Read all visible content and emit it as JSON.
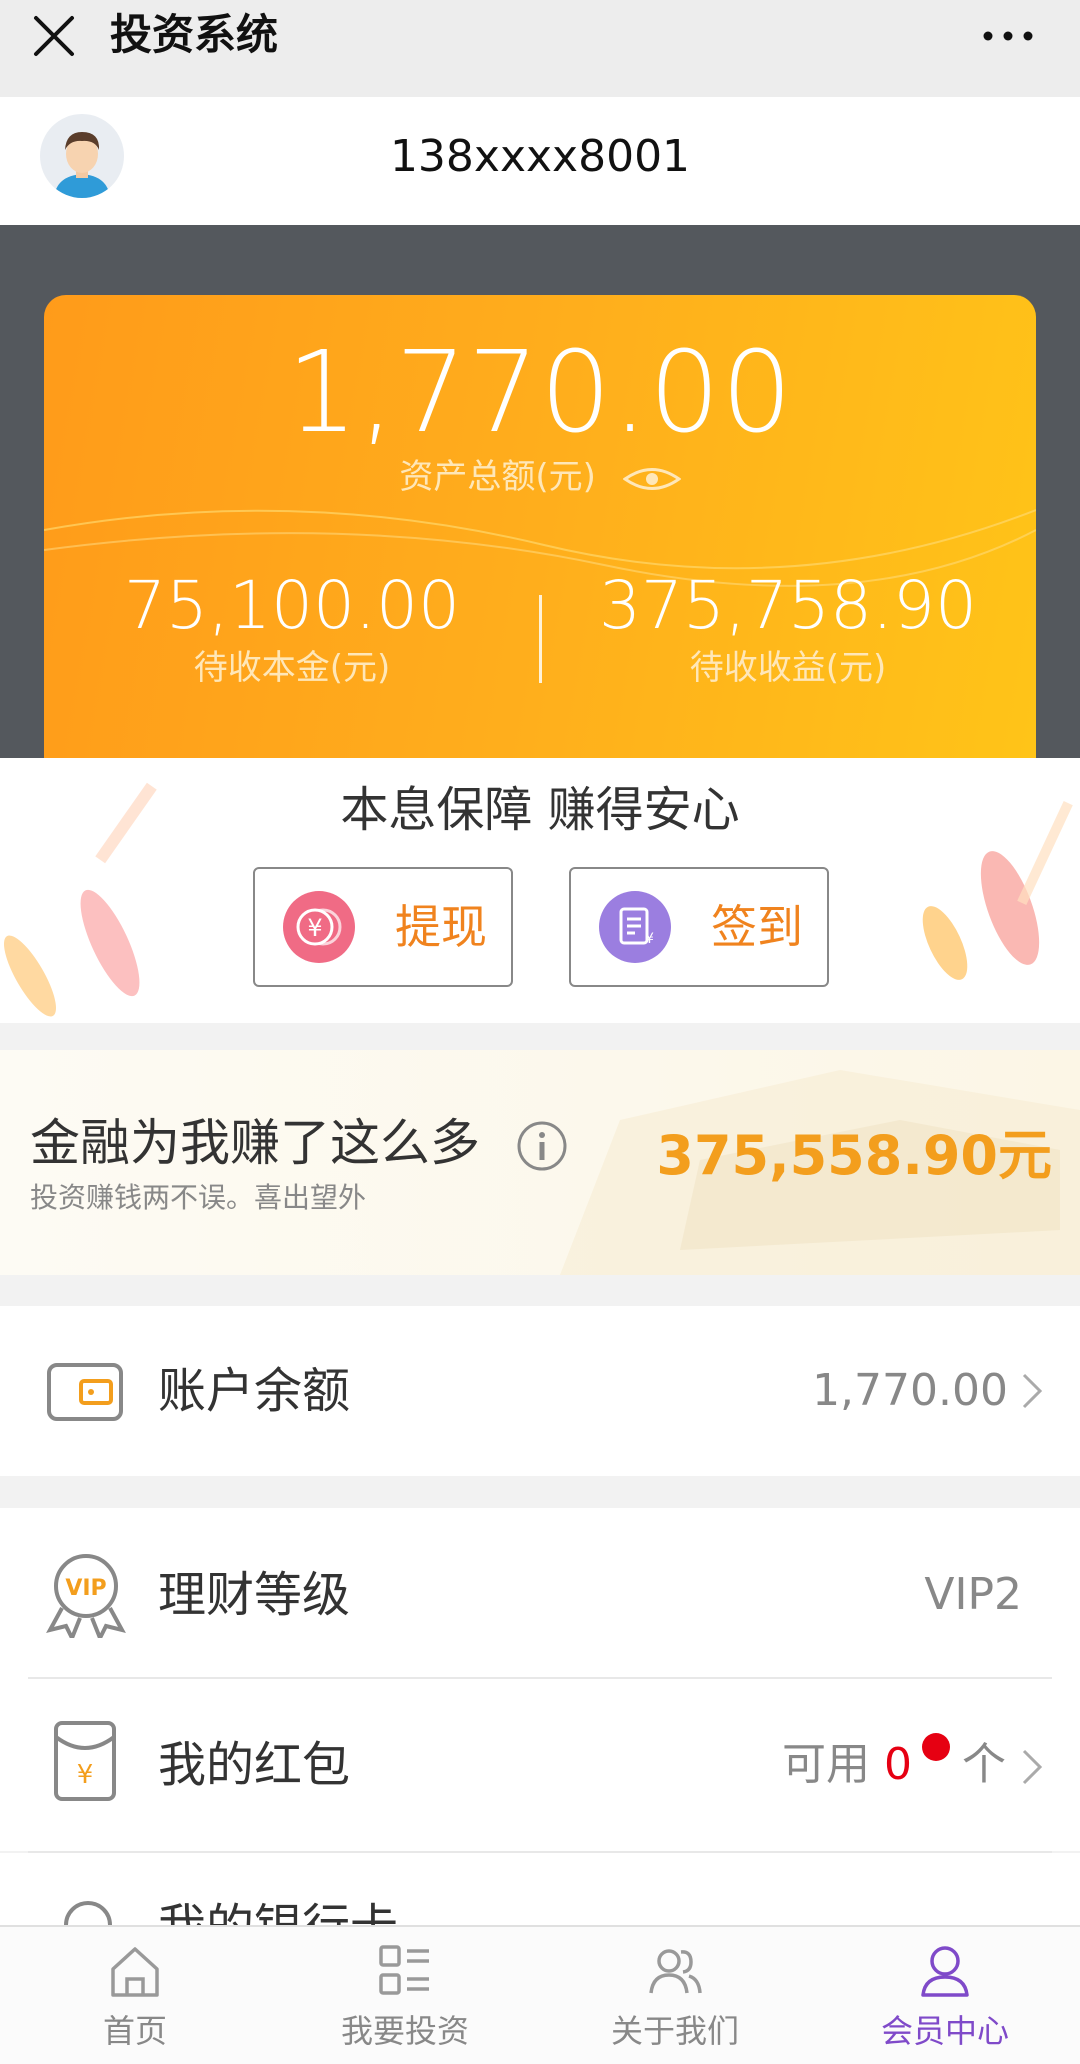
{
  "titlebar": {
    "title": "投资系统"
  },
  "profile": {
    "phone": "138xxxx8001"
  },
  "assets": {
    "total": "1,770.00",
    "total_label": "资产总额(元)",
    "pending_principal": "75,100.00",
    "pending_principal_label": "待收本金(元)",
    "pending_income": "375,758.90",
    "pending_income_label": "待收收益(元)"
  },
  "slogan": {
    "text": "本息保障 赚得安心",
    "withdraw_label": "提现",
    "checkin_label": "签到"
  },
  "earnings": {
    "title": "金融为我赚了这么多",
    "subtitle": "投资赚钱两不误。喜出望外",
    "value": "375,558.90元"
  },
  "rows": {
    "balance": {
      "label": "账户余额",
      "value": "1,770.00"
    },
    "level": {
      "label": "理财等级",
      "value": "VIP2"
    },
    "redpacket": {
      "label": "我的红包",
      "prefix": "可用",
      "count": "0",
      "unit": "个"
    },
    "bankcard": {
      "label": "我的银行卡"
    }
  },
  "tabs": [
    {
      "label": "首页",
      "icon": "home-icon"
    },
    {
      "label": "我要投资",
      "icon": "grid-list-icon"
    },
    {
      "label": "关于我们",
      "icon": "users-icon"
    },
    {
      "label": "会员中心",
      "icon": "person-icon"
    }
  ],
  "colors": {
    "accent_orange": "#f39e1d",
    "card_gradient_start": "#ff9b1a",
    "card_gradient_end": "#ffc418",
    "active_tab": "#7f4ac9",
    "badge_red": "#e60012"
  }
}
